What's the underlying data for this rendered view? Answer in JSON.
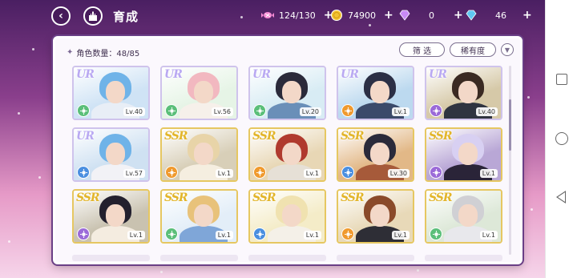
{
  "header": {
    "title": "育成",
    "resources": [
      {
        "icon": "candy-icon",
        "value": "124/130",
        "color": "#e86ac6"
      },
      {
        "icon": "coin-icon",
        "value": "74900",
        "color": "#f1c232"
      },
      {
        "icon": "pink-diamond-icon",
        "value": "0",
        "color": "#c084f5"
      },
      {
        "icon": "blue-diamond-icon",
        "value": "46",
        "color": "#5fc6f2"
      }
    ],
    "plus": "+"
  },
  "panel": {
    "count_label": "角色数量：48/85",
    "filter_label": "筛 选",
    "rarity_label": "稀有度"
  },
  "cards": [
    {
      "rarity": "UR",
      "level": "Lv.40",
      "attr_color": "#5bbf7a",
      "hair": "#6fb3e8",
      "outfit": "#e8eef6",
      "bg": "#cfe3f5"
    },
    {
      "rarity": "UR",
      "level": "Lv.56",
      "attr_color": "#5bbf7a",
      "hair": "#f2b8c0",
      "outfit": "#f6f0ea",
      "bg": "#e6f4e6"
    },
    {
      "rarity": "UR",
      "level": "Lv.20",
      "attr_color": "#5bbf7a",
      "hair": "#2a2a3a",
      "outfit": "#6a8fb8",
      "bg": "#d8ecf4"
    },
    {
      "rarity": "UR",
      "level": "Lv.1",
      "attr_color": "#f09a2e",
      "hair": "#2b2f45",
      "outfit": "#3b4a6a",
      "bg": "#bcd9ef"
    },
    {
      "rarity": "UR",
      "level": "Lv.40",
      "attr_color": "#9b6ad8",
      "hair": "#3a2a22",
      "outfit": "#2f3440",
      "bg": "#d6c9a8"
    },
    {
      "rarity": "UR",
      "level": "Lv.57",
      "attr_color": "#4a8fe0",
      "hair": "#6fb3e8",
      "outfit": "#f2f2f6",
      "bg": "#cfe1f2"
    },
    {
      "rarity": "SSR",
      "level": "Lv.1",
      "attr_color": "#f09a2e",
      "hair": "#e8d4a8",
      "outfit": "#f5eee0",
      "bg": "#d8cfb8"
    },
    {
      "rarity": "SSR",
      "level": "Lv.1",
      "attr_color": "#f09a2e",
      "hair": "#b03a2e",
      "outfit": "#e6e0d6",
      "bg": "#e8d7b5"
    },
    {
      "rarity": "SSR",
      "level": "Lv.30",
      "attr_color": "#4a8fe0",
      "hair": "#2a2a3a",
      "outfit": "#a65a3a",
      "bg": "#e2b887"
    },
    {
      "rarity": "SSR",
      "level": "Lv.1",
      "attr_color": "#9b6ad8",
      "hair": "#d8d0f2",
      "outfit": "#2a2438",
      "bg": "#b9a7d6"
    },
    {
      "rarity": "SSR",
      "level": "Lv.1",
      "attr_color": "#9b6ad8",
      "hair": "#23202e",
      "outfit": "#f4ece0",
      "bg": "#c9c2b0"
    },
    {
      "rarity": "SSR",
      "level": "Lv.1",
      "attr_color": "#5bbf7a",
      "hair": "#e8c27a",
      "outfit": "#7fa6d8",
      "bg": "#e3eef8"
    },
    {
      "rarity": "SSR",
      "level": "Lv.1",
      "attr_color": "#4a8fe0",
      "hair": "#f0e2b0",
      "outfit": "#f4f0e8",
      "bg": "#f4ecc8"
    },
    {
      "rarity": "SSR",
      "level": "Lv.1",
      "attr_color": "#f09a2e",
      "hair": "#8a4a2a",
      "outfit": "#2e2e36",
      "bg": "#e8d9b8"
    },
    {
      "rarity": "SSR",
      "level": "Lv.1",
      "attr_color": "#5bbf7a",
      "hair": "#d0d0d4",
      "outfit": "#e8e8ec",
      "bg": "#dde8d8"
    }
  ]
}
